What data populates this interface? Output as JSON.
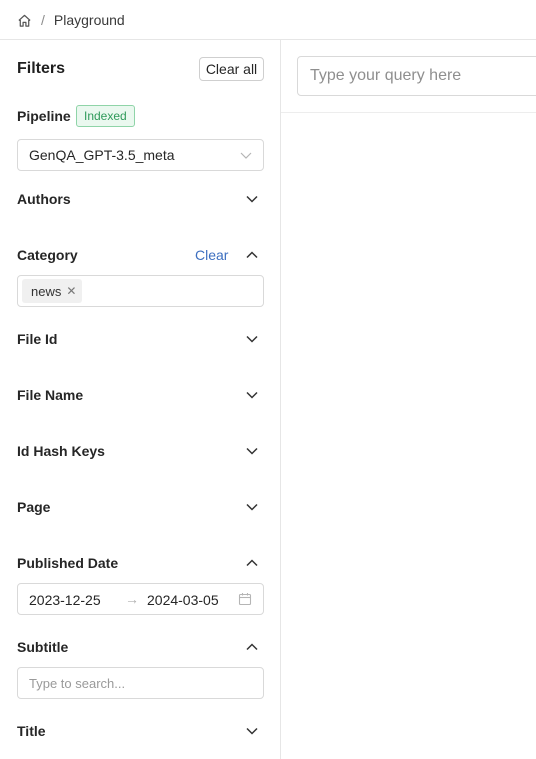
{
  "breadcrumb": {
    "icon": "home-icon",
    "separator": "/",
    "current": "Playground"
  },
  "filters": {
    "title": "Filters",
    "clear_all_label": "Clear all",
    "pipeline": {
      "label": "Pipeline",
      "badge": "Indexed",
      "selected": "GenQA_GPT-3.5_meta"
    },
    "authors": {
      "label": "Authors",
      "expanded": false
    },
    "category": {
      "label": "Category",
      "clear_label": "Clear",
      "expanded": true,
      "tags": [
        "news"
      ]
    },
    "file_id": {
      "label": "File Id",
      "expanded": false
    },
    "file_name": {
      "label": "File Name",
      "expanded": false
    },
    "id_hash_keys": {
      "label": "Id Hash Keys",
      "expanded": false
    },
    "page": {
      "label": "Page",
      "expanded": false
    },
    "published_date": {
      "label": "Published Date",
      "expanded": true,
      "start": "2023-12-25",
      "arrow": "→",
      "end": "2024-03-05"
    },
    "subtitle": {
      "label": "Subtitle",
      "expanded": true,
      "placeholder": "Type to search..."
    },
    "title_filter": {
      "label": "Title",
      "expanded": false
    }
  },
  "main": {
    "query_placeholder": "Type your query here"
  },
  "colors": {
    "indexed_badge_text": "#2f9a5a",
    "indexed_badge_bg": "#eaf8ef",
    "clear_link": "#3d6fc0",
    "border": "#d9d9d9"
  }
}
